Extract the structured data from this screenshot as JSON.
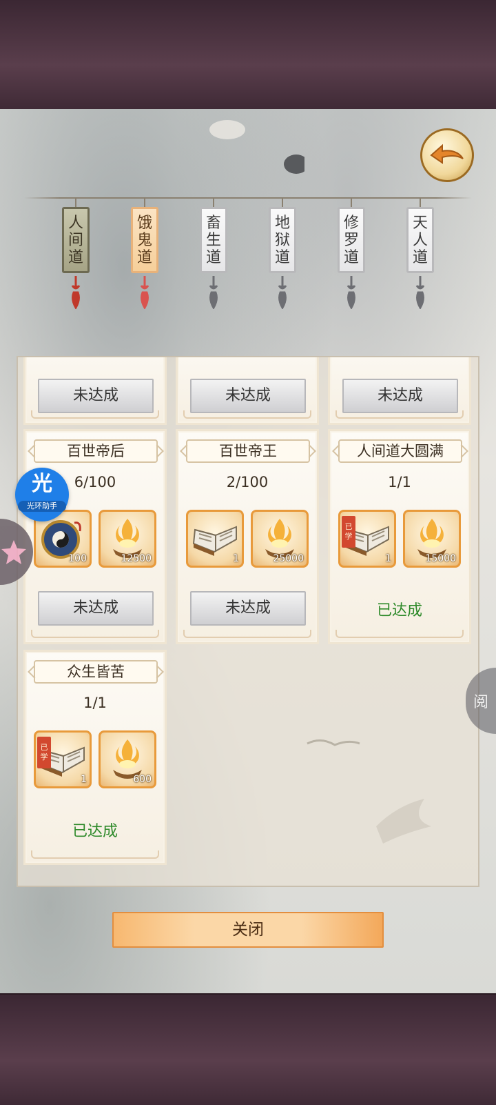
{
  "tabs": [
    {
      "lines": [
        "人",
        "间",
        "道"
      ],
      "state": "active"
    },
    {
      "lines": [
        "饿",
        "鬼",
        "道"
      ],
      "state": "hover"
    },
    {
      "lines": [
        "畜",
        "生",
        "道"
      ],
      "state": "normal"
    },
    {
      "lines": [
        "地",
        "狱",
        "道"
      ],
      "state": "normal"
    },
    {
      "lines": [
        "修",
        "罗",
        "道"
      ],
      "state": "normal"
    },
    {
      "lines": [
        "天",
        "人",
        "道"
      ],
      "state": "normal"
    }
  ],
  "status": {
    "unreached": "未达成",
    "reached": "已达成",
    "learned_badge": [
      "已",
      "学"
    ]
  },
  "cards": {
    "c1": {
      "title": "百世帝后",
      "progress": "6/100",
      "item1_icon": "taiji-compass-icon",
      "item1_count": "100",
      "item2_icon": "flame-bowl-icon",
      "item2_count": "12500"
    },
    "c2": {
      "title": "百世帝王",
      "progress": "2/100",
      "item1_icon": "book-icon",
      "item1_count": "1",
      "item2_icon": "flame-bowl-icon",
      "item2_count": "25000"
    },
    "c3": {
      "title": "人间道大圆满",
      "progress": "1/1",
      "item1_icon": "book-icon",
      "item1_count": "1",
      "item2_icon": "flame-bowl-icon",
      "item2_count": "15000"
    },
    "c4": {
      "title": "众生皆苦",
      "progress": "1/1",
      "item1_icon": "book-icon",
      "item1_count": "1",
      "item2_icon": "flame-bowl-icon",
      "item2_count": "600"
    }
  },
  "close_label": "关闭",
  "overlay": {
    "helper_big": "光",
    "helper_small": "光环助手",
    "read_label": "阅"
  },
  "colors": {
    "accent_orange": "#e89a3b",
    "reached_green": "#2e8a2a",
    "band_purple": "#4a3340"
  }
}
